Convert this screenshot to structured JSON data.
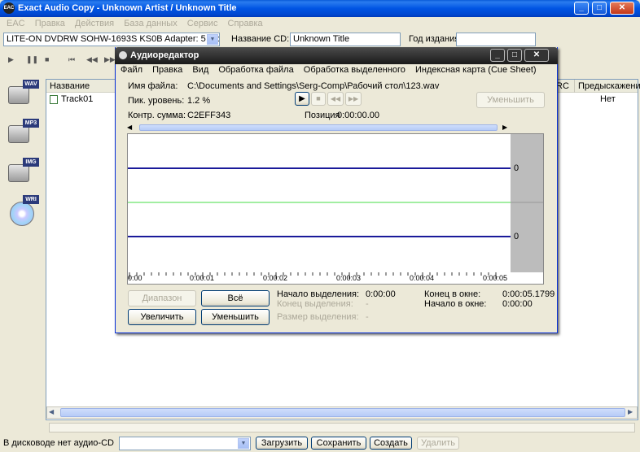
{
  "main_window": {
    "title": "Exact Audio Copy   -   Unknown Artist / Unknown Title",
    "menu": [
      "EAC",
      "Правка",
      "Действия",
      "База данных",
      "Сервис",
      "Справка"
    ],
    "drive": "LITE-ON DVDRW SOHW-1693S KS0B  Adapter: 5  ID: 1",
    "cd_title_label": "Название CD:",
    "cd_title_value": "Unknown Title",
    "year_label": "Год издания:",
    "year_value": "",
    "toolbar_icons": [
      "play-icon",
      "pause-icon",
      "stop-icon",
      "first-track-icon",
      "prev-track-icon",
      "rewind-icon",
      "forward-icon"
    ],
    "side_buttons": [
      "WAV",
      "MP3",
      "IMG",
      "WRI"
    ],
    "columns": {
      "name": "Название",
      "crc": "RC",
      "preemphasis": "Предыскажение"
    },
    "tracks": [
      {
        "name": "Track01",
        "preemphasis": "Нет"
      }
    ],
    "status_text": "В дисководе нет аудио-CD",
    "bottom_buttons": {
      "load": "Загрузить",
      "save": "Сохранить",
      "create": "Создать",
      "delete": "Удалить"
    }
  },
  "editor": {
    "title": "Аудиоредактор",
    "menu": [
      "Файл",
      "Правка",
      "Вид",
      "Обработка файла",
      "Обработка выделенного",
      "Индексная карта (Cue Sheet)"
    ],
    "file_name_label": "Имя файла:",
    "file_name": "C:\\Documents and Settings\\Serg-Comp\\Рабочий стол\\123.wav",
    "peak_label": "Пик. уровень:",
    "peak_value": "1.2 %",
    "checksum_label": "Контр. сумма:",
    "checksum_value": "C2EFF343",
    "position_label": "Позиция",
    "position_value": "0:00:00.00",
    "reduce_button": "Уменьшить",
    "channel_scale": [
      "0",
      "0"
    ],
    "time_ticks": [
      "0:00",
      "0:00:01",
      "0:00:02",
      "0:00:03",
      "0:00:04",
      "0:00:05"
    ],
    "range_button": "Диапазон",
    "all_button": "Всё",
    "zoom_in_button": "Увеличить",
    "zoom_out_button": "Уменьшить",
    "sel_start_label": "Начало выделения:",
    "sel_start_value": "0:00:00",
    "sel_end_label": "Конец выделения:",
    "sel_end_value": "-",
    "sel_size_label": "Размер выделения:",
    "sel_size_value": "-",
    "win_end_label": "Конец в окне:",
    "win_end_value": "0:00:05.1799",
    "win_start_label": "Начало в окне:",
    "win_start_value": "0:00:00",
    "colors": {
      "waveform": "#1a1a9a",
      "center": "#44dd44",
      "ruler": "#bcbcbc"
    }
  }
}
